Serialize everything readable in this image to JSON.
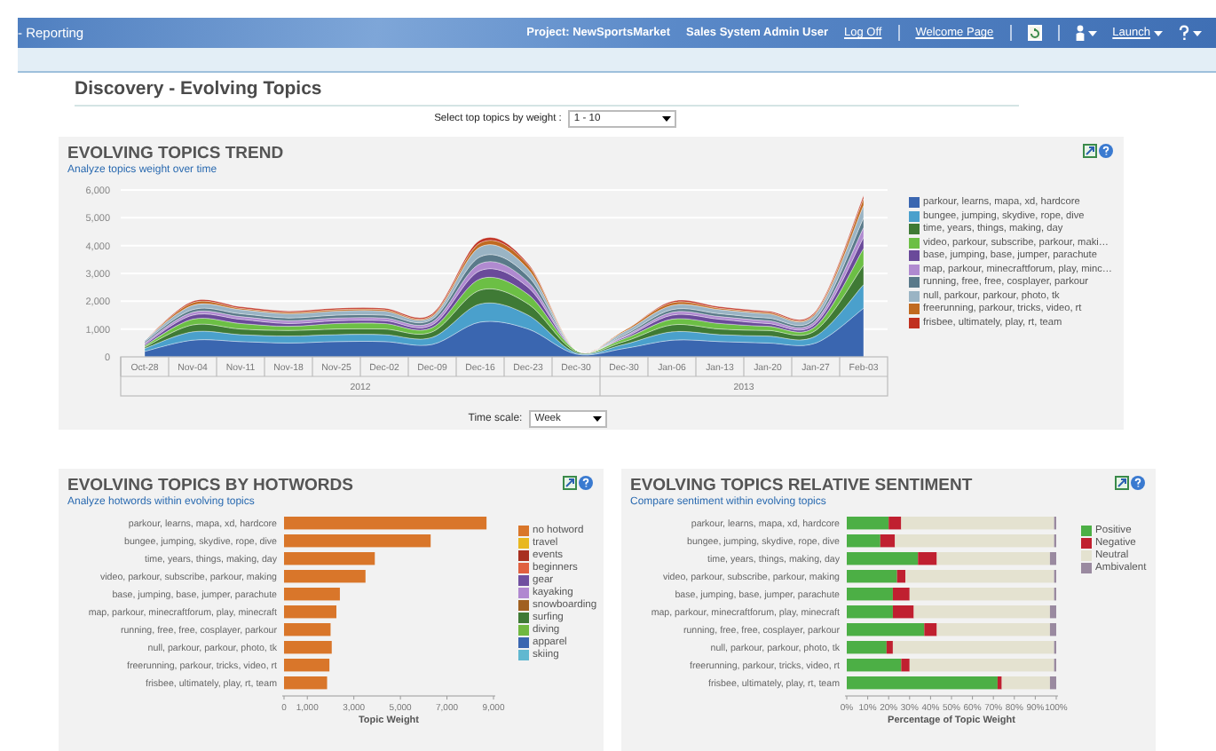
{
  "header": {
    "app_title": "- Reporting",
    "project": "Project: NewSportsMarket",
    "user": "Sales System Admin User",
    "links": [
      "Log Off",
      "Welcome Page"
    ],
    "launch": "Launch"
  },
  "page_title": "Discovery - Evolving Topics",
  "topic_filter": {
    "label": "Select top topics by weight :",
    "value": "1 - 10"
  },
  "trend": {
    "title": "EVOLVING TOPICS TREND",
    "subtitle": "Analyze topics weight over time",
    "chart_data": {
      "type": "area",
      "stacked": true,
      "categories": [
        "Oct-28",
        "Nov-04",
        "Nov-11",
        "Nov-18",
        "Nov-25",
        "Dec-02",
        "Dec-09",
        "Dec-16",
        "Dec-23",
        "Dec-30",
        "Dec-30",
        "Jan-06",
        "Jan-13",
        "Jan-20",
        "Jan-27",
        "Feb-03"
      ],
      "annotations": [
        "2012",
        "2013"
      ],
      "grid": true,
      "ylim": [
        0,
        6000
      ],
      "yticks": [
        0,
        {
          "value": 1000,
          "label": "1,000"
        },
        {
          "value": 2000,
          "label": "2,000"
        },
        {
          "value": 3000,
          "label": "3,000"
        },
        {
          "value": 4000,
          "label": "4,000"
        },
        {
          "value": 5000,
          "label": "5,000"
        },
        {
          "value": 6000,
          "label": "6,000"
        }
      ],
      "series": [
        {
          "name": "parkour, learns, mapa, xd, hardcore",
          "color": "#3a66b0",
          "values": [
            200,
            600,
            550,
            500,
            550,
            550,
            450,
            1250,
            1000,
            100,
            300,
            600,
            550,
            500,
            500,
            1750
          ]
        },
        {
          "name": "bungee, jumping, skydive, rope, dive",
          "color": "#4aa0cc",
          "values": [
            100,
            300,
            250,
            250,
            250,
            250,
            250,
            650,
            500,
            50,
            150,
            300,
            250,
            250,
            250,
            850
          ]
        },
        {
          "name": "time, years, things, making, day",
          "color": "#3f7a35",
          "values": [
            50,
            250,
            200,
            200,
            200,
            200,
            200,
            500,
            400,
            50,
            100,
            250,
            200,
            200,
            200,
            700
          ]
        },
        {
          "name": "video, parkour, subscribe, parkour, maki…",
          "color": "#6cbf45",
          "values": [
            50,
            200,
            200,
            150,
            200,
            200,
            150,
            400,
            350,
            50,
            100,
            200,
            200,
            150,
            150,
            600
          ]
        },
        {
          "name": "base, jumping, base, jumper, parachute",
          "color": "#6a4a9a",
          "values": [
            50,
            150,
            150,
            100,
            100,
            100,
            100,
            300,
            250,
            0,
            50,
            150,
            150,
            100,
            100,
            400
          ]
        },
        {
          "name": "map, parkour, minecraftforum, play, minc…",
          "color": "#b08ad0",
          "values": [
            50,
            100,
            100,
            100,
            100,
            100,
            100,
            250,
            200,
            0,
            50,
            100,
            100,
            100,
            100,
            350
          ]
        },
        {
          "name": "running, free, free, cosplayer, parkour",
          "color": "#5a7a8a",
          "values": [
            50,
            100,
            100,
            100,
            100,
            100,
            100,
            250,
            200,
            0,
            50,
            100,
            100,
            100,
            100,
            350
          ]
        },
        {
          "name": "null, parkour, parkour, photo, tk",
          "color": "#9ab4c4",
          "values": [
            50,
            150,
            150,
            150,
            150,
            150,
            100,
            350,
            250,
            0,
            100,
            150,
            150,
            150,
            150,
            450
          ]
        },
        {
          "name": "freerunning, parkour, tricks, video, rt",
          "color": "#c06a20",
          "values": [
            0,
            100,
            50,
            50,
            50,
            50,
            50,
            150,
            150,
            0,
            50,
            100,
            50,
            50,
            50,
            250
          ]
        },
        {
          "name": "frisbee, ultimately, play, rt, team",
          "color": "#c03020",
          "values": [
            0,
            50,
            50,
            50,
            50,
            50,
            50,
            100,
            50,
            0,
            0,
            50,
            50,
            50,
            50,
            100
          ]
        }
      ]
    },
    "time_scale": {
      "label": "Time scale:",
      "value": "Week"
    }
  },
  "hotwords": {
    "title": "EVOLVING TOPICS BY HOTWORDS",
    "subtitle": "Analyze hotwords within evolving topics",
    "chart_data": {
      "type": "bar",
      "orientation": "horizontal",
      "stacked": true,
      "xlabel": "Topic Weight",
      "xlim": [
        0,
        9000
      ],
      "xticks": [
        0,
        {
          "value": 1000,
          "label": "1,000"
        },
        {
          "value": 3000,
          "label": "3,000"
        },
        {
          "value": 5000,
          "label": "5,000"
        },
        {
          "value": 7000,
          "label": "7,000"
        },
        {
          "value": 9000,
          "label": "9,000"
        }
      ],
      "categories": [
        "parkour, learns, mapa, xd, hardcore",
        "bungee, jumping, skydive, rope, dive",
        "time, years, things, making, day",
        "video, parkour, subscribe, parkour, making",
        "base, jumping, base, jumper, parachute",
        "map, parkour, minecraftforum, play, minecraft",
        "running, free, free, cosplayer, parkour",
        "null, parkour, parkour, photo, tk",
        "freerunning, parkour, tricks, video, rt",
        "frisbee, ultimately, play, rt, team"
      ],
      "series": [
        {
          "name": "no hotword",
          "color": "#d9762a",
          "values": [
            8700,
            6300,
            3900,
            3500,
            2400,
            2250,
            2000,
            2050,
            1950,
            1850
          ]
        },
        {
          "name": "travel",
          "color": "#e8b820",
          "values": [
            0,
            0,
            0,
            0,
            0,
            0,
            0,
            0,
            0,
            0
          ]
        },
        {
          "name": "events",
          "color": "#a83020",
          "values": [
            0,
            0,
            0,
            0,
            0,
            0,
            0,
            0,
            0,
            0
          ]
        },
        {
          "name": "beginners",
          "color": "#e06040",
          "values": [
            0,
            0,
            0,
            0,
            0,
            0,
            0,
            0,
            0,
            0
          ]
        },
        {
          "name": "gear",
          "color": "#7050a0",
          "values": [
            0,
            0,
            0,
            0,
            0,
            0,
            0,
            0,
            0,
            0
          ]
        },
        {
          "name": "kayaking",
          "color": "#b088d0",
          "values": [
            0,
            0,
            0,
            0,
            0,
            0,
            0,
            0,
            0,
            0
          ]
        },
        {
          "name": "snowboarding",
          "color": "#a06020",
          "values": [
            0,
            0,
            0,
            0,
            0,
            0,
            0,
            0,
            0,
            0
          ]
        },
        {
          "name": "surfing",
          "color": "#3f7a35",
          "values": [
            0,
            0,
            0,
            0,
            0,
            0,
            0,
            0,
            0,
            0
          ]
        },
        {
          "name": "diving",
          "color": "#70b840",
          "values": [
            0,
            0,
            0,
            0,
            0,
            0,
            0,
            0,
            0,
            0
          ]
        },
        {
          "name": "apparel",
          "color": "#3a66b0",
          "values": [
            0,
            0,
            0,
            0,
            0,
            0,
            0,
            0,
            0,
            0
          ]
        },
        {
          "name": "skiing",
          "color": "#60b8d0",
          "values": [
            0,
            0,
            0,
            0,
            0,
            0,
            0,
            0,
            0,
            0
          ]
        }
      ]
    }
  },
  "sentiment": {
    "title": "EVOLVING TOPICS RELATIVE SENTIMENT",
    "subtitle": "Compare sentiment within evolving topics",
    "chart_data": {
      "type": "bar",
      "orientation": "horizontal",
      "stacked": true,
      "xlabel": "Percentage of Topic Weight",
      "xlim": [
        0,
        100
      ],
      "xticks": [
        {
          "value": 0,
          "label": "0%"
        },
        {
          "value": 10,
          "label": "10%"
        },
        {
          "value": 20,
          "label": "20%"
        },
        {
          "value": 30,
          "label": "30%"
        },
        {
          "value": 40,
          "label": "40%"
        },
        {
          "value": 50,
          "label": "50%"
        },
        {
          "value": 60,
          "label": "60%"
        },
        {
          "value": 70,
          "label": "70%"
        },
        {
          "value": 80,
          "label": "80%"
        },
        {
          "value": 90,
          "label": "90%"
        },
        {
          "value": 100,
          "label": "100%"
        }
      ],
      "categories": [
        "parkour, learns, mapa, xd, hardcore",
        "bungee, jumping, skydive, rope, dive",
        "time, years, things, making, day",
        "video, parkour, subscribe, parkour, making",
        "base, jumping, base, jumper, parachute",
        "map, parkour, minecraftforum, play, minecraft",
        "running, free, free, cosplayer, parkour",
        "null, parkour, parkour, photo, tk",
        "freerunning, parkour, tricks, video, rt",
        "frisbee, ultimately, play, rt, team"
      ],
      "series": [
        {
          "name": "Positive",
          "color": "#4caf45",
          "values": [
            20,
            16,
            34,
            24,
            22,
            22,
            37,
            19,
            26,
            72
          ]
        },
        {
          "name": "Negative",
          "color": "#c02030",
          "values": [
            6,
            7,
            9,
            4,
            8,
            10,
            6,
            3,
            4,
            2
          ]
        },
        {
          "name": "Neutral",
          "color": "#e4e2d0",
          "values": [
            73,
            76,
            54,
            71,
            69,
            65,
            54,
            77,
            69,
            23
          ]
        },
        {
          "name": "Ambivalent",
          "color": "#9a8aa0",
          "values": [
            1,
            1,
            3,
            1,
            1,
            3,
            3,
            1,
            1,
            3
          ]
        }
      ]
    }
  }
}
